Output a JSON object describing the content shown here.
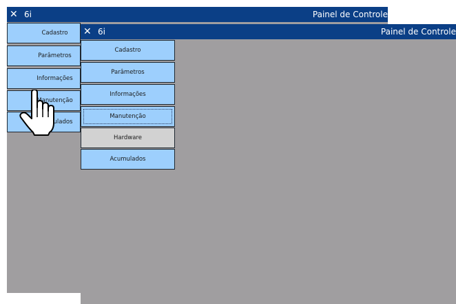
{
  "window_back": {
    "title_left": "6i",
    "title_right": "Painel de Controle",
    "menu": [
      "Cadastro",
      "Parâmetros",
      "Informações",
      "Manutenção",
      "Acumulados"
    ]
  },
  "window_front": {
    "title_left": "6i",
    "title_right": "Painel de Controle",
    "menu": [
      "Cadastro",
      "Parâmetros",
      "Informações",
      "Manutenção",
      "Hardware",
      "Acumulados"
    ]
  },
  "icons": {
    "close": "close-icon",
    "cursor": "hand-pointer-cursor"
  },
  "colors": {
    "titlebar": "#0b3f86",
    "button": "#9dcffd",
    "button_disabled": "#d2d2d2",
    "background": "#a09ea0"
  }
}
